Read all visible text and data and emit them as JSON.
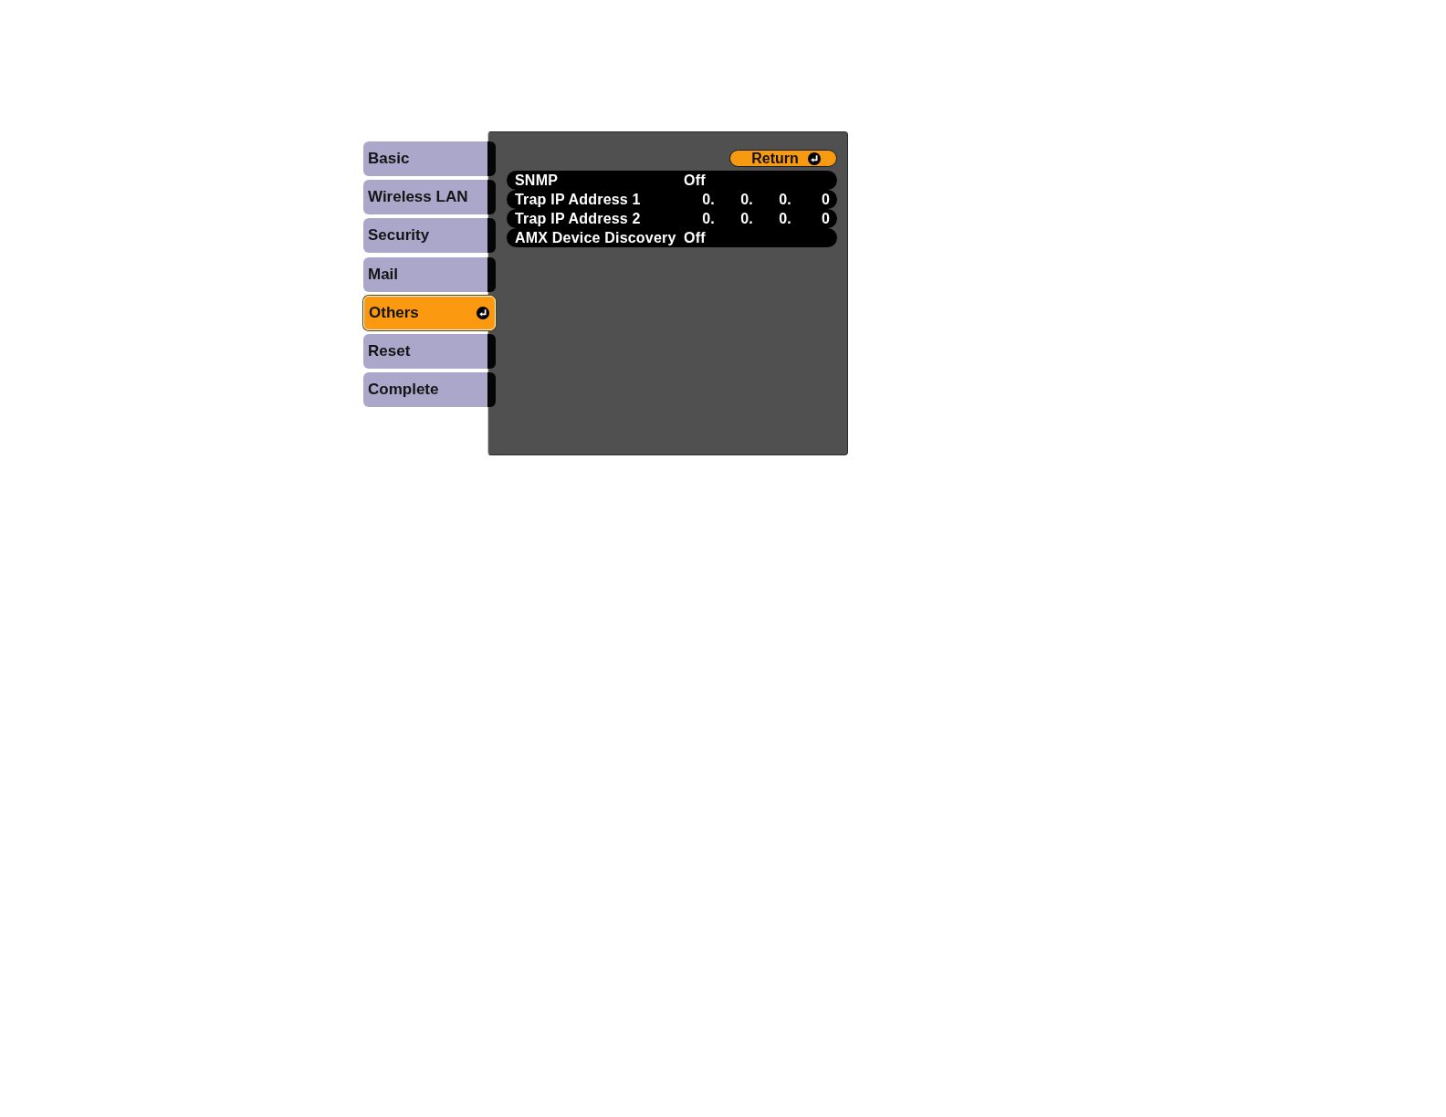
{
  "menu": {
    "items": [
      {
        "label": "Basic",
        "selected": false
      },
      {
        "label": "Wireless LAN",
        "selected": false
      },
      {
        "label": "Security",
        "selected": false
      },
      {
        "label": "Mail",
        "selected": false
      },
      {
        "label": "Others",
        "selected": true
      },
      {
        "label": "Reset",
        "selected": false
      },
      {
        "label": "Complete",
        "selected": false
      }
    ]
  },
  "panel": {
    "return_button": {
      "label": "Return"
    },
    "settings": [
      {
        "kind": "option",
        "label": "SNMP",
        "value": "Off"
      },
      {
        "kind": "ip",
        "label": "Trap IP Address 1",
        "octets": [
          "0.",
          "0.",
          "0.",
          "0"
        ]
      },
      {
        "kind": "ip",
        "label": "Trap IP Address 2",
        "octets": [
          "0.",
          "0.",
          "0.",
          "0"
        ]
      },
      {
        "kind": "option",
        "label": "AMX Device Discovery",
        "value": "Off"
      }
    ]
  }
}
